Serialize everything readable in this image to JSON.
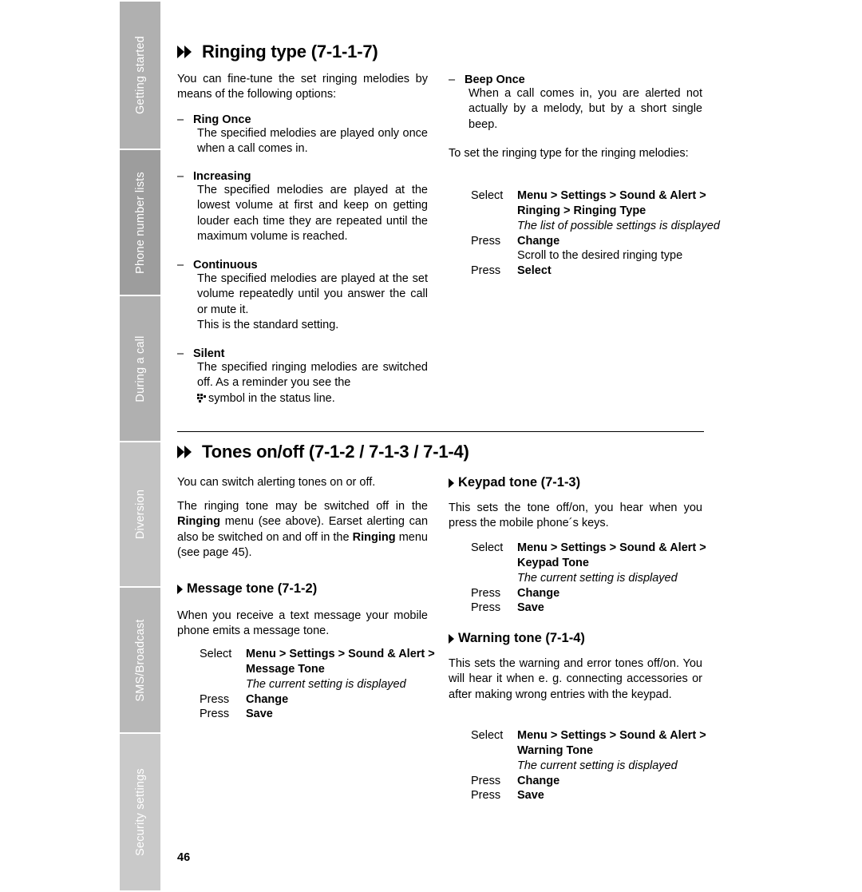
{
  "tabs": [
    {
      "label": "Getting started"
    },
    {
      "label": "Phone number lists"
    },
    {
      "label": "During a call"
    },
    {
      "label": "Diversion"
    },
    {
      "label": "SMS/Broadcast"
    },
    {
      "label": "Security settings"
    }
  ],
  "page_number": "46",
  "sections": {
    "ringing_type": {
      "title": "Ringing type (7-1-1-7)",
      "intro": "You can fine-tune the set ringing melodies by means of the following options:",
      "options": [
        {
          "term": "Ring Once",
          "text": "The specified melodies are played only once when a call comes in."
        },
        {
          "term": "Increasing",
          "text": "The specified melodies are played at the lowest volume at first and keep on getting louder each time they are repeated until the maximum volume is reached."
        },
        {
          "term": "Continuous",
          "text": "The specified melodies are played at the set volume repeatedly until you answer the call or mute it.",
          "text2": "This is the standard setting."
        },
        {
          "term": "Silent",
          "text": "The specified ringing melodies are switched off. As a reminder you see the",
          "text2": "symbol in the status line."
        },
        {
          "term": "Beep Once",
          "text": "When a call comes in, you are alerted not actually by a melody, but by a short single beep."
        }
      ],
      "set_intro": "To set the ringing type for the ringing melodies:",
      "procedure": [
        {
          "label": "Select",
          "value": "Menu > Settings > Sound & Alert >",
          "cont": "Ringing > Ringing Type",
          "italic": "The list of possible settings is displayed"
        },
        {
          "label": "Press",
          "value": "Change"
        },
        {
          "label": "",
          "value": "Scroll to the desired ringing type",
          "plain": true
        },
        {
          "label": "Press",
          "value": "Select"
        }
      ]
    },
    "tones_onoff": {
      "title": "Tones on/off (7-1-2 / 7-1-3 / 7-1-4)",
      "intro1": "You can switch alerting tones on or off.",
      "intro2_a": "The ringing tone may be switched off in the",
      "intro2_bold1": "Ringing",
      "intro2_b": "menu (see above). Earset alerting can also be switched on and off in the",
      "intro2_bold2": "Ringing",
      "intro2_c": "menu (see page 45).",
      "message_tone": {
        "title": "Message tone (7-1-2)",
        "text": "When you receive a text message your mobile phone emits a message tone.",
        "procedure": [
          {
            "label": "Select",
            "value": "Menu > Settings > Sound & Alert >",
            "cont": "Message Tone",
            "italic": "The current setting is displayed"
          },
          {
            "label": "Press",
            "value": "Change"
          },
          {
            "label": "Press",
            "value": "Save"
          }
        ]
      },
      "keypad_tone": {
        "title": "Keypad tone (7-1-3)",
        "text": "This sets the tone off/on, you hear when you press the mobile phone´s keys.",
        "procedure": [
          {
            "label": "Select",
            "value": "Menu > Settings > Sound & Alert >",
            "cont": "Keypad Tone",
            "italic": "The current setting is displayed"
          },
          {
            "label": "Press",
            "value": "Change"
          },
          {
            "label": "Press",
            "value": "Save"
          }
        ]
      },
      "warning_tone": {
        "title": "Warning tone (7-1-4)",
        "text": "This sets the warning and error tones off/on. You will hear it when e. g. connecting accessories or after making wrong entries with the keypad.",
        "procedure": [
          {
            "label": "Select",
            "value": "Menu > Settings > Sound & Alert >",
            "cont": "Warning Tone",
            "italic": "The current setting is displayed"
          },
          {
            "label": "Press",
            "value": "Change"
          },
          {
            "label": "Press",
            "value": "Save"
          }
        ]
      }
    }
  }
}
